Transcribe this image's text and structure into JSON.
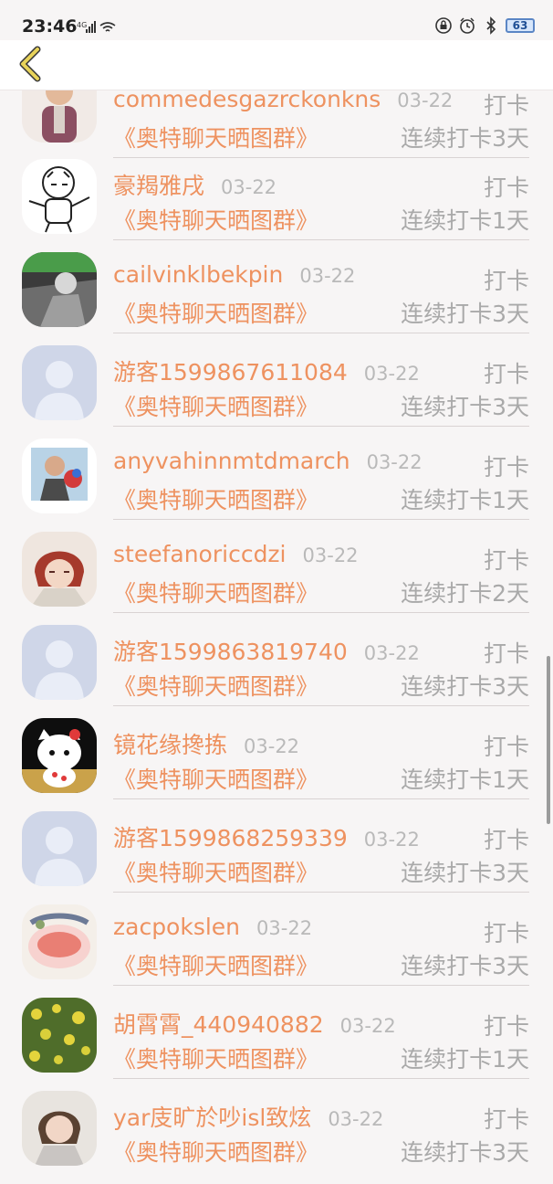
{
  "status": {
    "time": "23:46",
    "network": "4G",
    "battery": "63"
  },
  "toolbar": {
    "back_icon": "chevron-left-icon",
    "accent": "#e8d35a"
  },
  "colors": {
    "name": "#ee9260",
    "muted": "#a9a9a9",
    "date": "#b9b9b9"
  },
  "items": [
    {
      "name": "commedesgazrckonkns",
      "date": "03-22",
      "action": "打卡",
      "group": "《奥特聊天晒图群》",
      "streak": "连续打卡3天",
      "avatar": "cartoon-man-avatar"
    },
    {
      "name": "豪羯雅戌",
      "date": "03-22",
      "action": "打卡",
      "group": "《奥特聊天晒图群》",
      "streak": "连续打卡1天",
      "avatar": "tiger-sketch-avatar"
    },
    {
      "name": "cailvinklbekpin",
      "date": "03-22",
      "action": "打卡",
      "group": "《奥特聊天晒图群》",
      "streak": "连续打卡3天",
      "avatar": "photo-avatar"
    },
    {
      "name": "游客1599867611084",
      "date": "03-22",
      "action": "打卡",
      "group": "《奥特聊天晒图群》",
      "streak": "连续打卡3天",
      "avatar": "default-avatar"
    },
    {
      "name": "anyvahinnmtdmarch",
      "date": "03-22",
      "action": "打卡",
      "group": "《奥特聊天晒图群》",
      "streak": "连续打卡1天",
      "avatar": "photo-avatar"
    },
    {
      "name": "steefanoriccdzi",
      "date": "03-22",
      "action": "打卡",
      "group": "《奥特聊天晒图群》",
      "streak": "连续打卡2天",
      "avatar": "anime-avatar"
    },
    {
      "name": "游客1599863819740",
      "date": "03-22",
      "action": "打卡",
      "group": "《奥特聊天晒图群》",
      "streak": "连续打卡3天",
      "avatar": "default-avatar"
    },
    {
      "name": "镜花缘搀拣",
      "date": "03-22",
      "action": "打卡",
      "group": "《奥特聊天晒图群》",
      "streak": "连续打卡1天",
      "avatar": "cat-avatar"
    },
    {
      "name": "游客1599868259339",
      "date": "03-22",
      "action": "打卡",
      "group": "《奥特聊天晒图群》",
      "streak": "连续打卡3天",
      "avatar": "default-avatar"
    },
    {
      "name": "zacpokslen",
      "date": "03-22",
      "action": "打卡",
      "group": "《奥特聊天晒图群》",
      "streak": "连续打卡3天",
      "avatar": "food-avatar"
    },
    {
      "name": "胡霄霄_440940882",
      "date": "03-22",
      "action": "打卡",
      "group": "《奥特聊天晒图群》",
      "streak": "连续打卡1天",
      "avatar": "flowers-avatar"
    },
    {
      "name": "yar庋旷於吵isl致炫",
      "date": "03-22",
      "action": "打卡",
      "group": "《奥特聊天晒图群》",
      "streak": "连续打卡3天",
      "avatar": "child-avatar"
    }
  ]
}
